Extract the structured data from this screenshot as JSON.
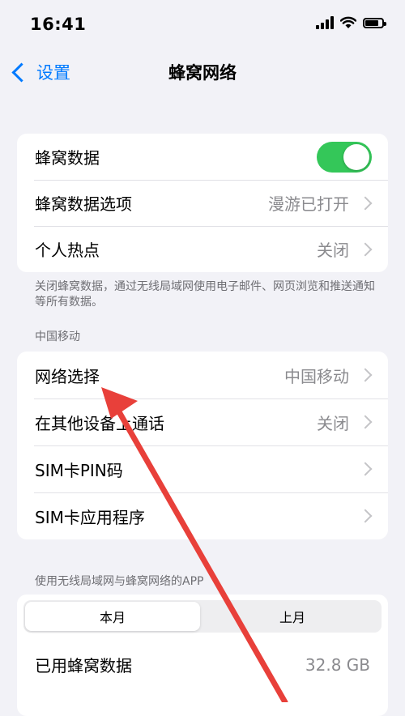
{
  "status_bar": {
    "time": "16:41",
    "battery_level": 0.8
  },
  "nav": {
    "back_label": "设置",
    "title": "蜂窝网络"
  },
  "group1": {
    "cellular_data": {
      "label": "蜂窝数据",
      "enabled": true
    },
    "data_options": {
      "label": "蜂窝数据选项",
      "value": "漫游已打开"
    },
    "hotspot": {
      "label": "个人热点",
      "value": "关闭"
    }
  },
  "note1": "关闭蜂窝数据，通过无线局域网使用电子邮件、网页浏览和推送通知等所有数据。",
  "carrier_section": "中国移动",
  "group2": {
    "network_selection": {
      "label": "网络选择",
      "value": "中国移动"
    },
    "calls_other_devices": {
      "label": "在其他设备上通话",
      "value": "关闭"
    },
    "sim_pin": {
      "label": "SIM卡PIN码"
    },
    "sim_apps": {
      "label": "SIM卡应用程序"
    }
  },
  "usage_section": "使用无线局域网与蜂窝网络的APP",
  "usage": {
    "segments": [
      "本月",
      "上月"
    ],
    "used_label": "已用蜂窝数据",
    "used_value": "32.8 GB"
  },
  "annotation": {
    "color": "#e8403a"
  }
}
